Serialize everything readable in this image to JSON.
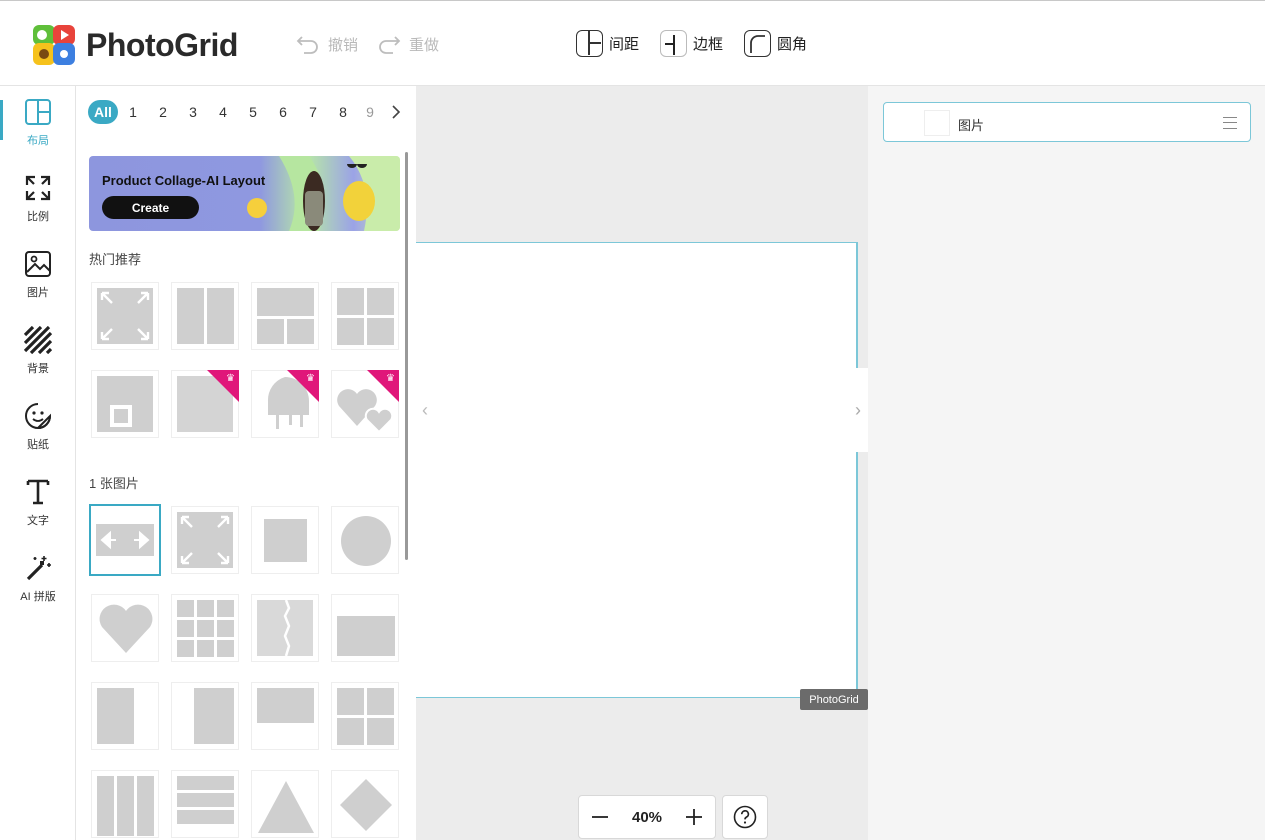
{
  "app": {
    "name": "PhotoGrid"
  },
  "header": {
    "undo_label": "撤销",
    "redo_label": "重做",
    "tools": [
      {
        "label": "间距",
        "icon": "spacing-icon"
      },
      {
        "label": "边框",
        "icon": "border-icon"
      },
      {
        "label": "圆角",
        "icon": "corner-radius-icon"
      }
    ]
  },
  "sidebar": {
    "items": [
      {
        "label": "布局",
        "icon": "layout-icon",
        "active": true
      },
      {
        "label": "比例",
        "icon": "ratio-icon"
      },
      {
        "label": "图片",
        "icon": "image-icon"
      },
      {
        "label": "背景",
        "icon": "background-icon"
      },
      {
        "label": "贴纸",
        "icon": "sticker-icon"
      },
      {
        "label": "文字",
        "icon": "text-icon"
      },
      {
        "label": "AI 拼版",
        "icon": "magic-wand-icon"
      }
    ]
  },
  "panel": {
    "pager": {
      "all": "All",
      "pages": [
        "1",
        "2",
        "3",
        "4",
        "5",
        "6",
        "7",
        "8",
        "9"
      ],
      "next_icon": "chevron-right-icon"
    },
    "banner": {
      "title": "Product Collage-AI Layout",
      "button": "Create"
    },
    "section_hot": "热门推荐",
    "section_one": "1 张图片"
  },
  "canvas": {
    "watermark": "PhotoGrid",
    "zoom": "40%"
  },
  "right": {
    "layer_label": "图片"
  },
  "colors": {
    "accent": "#3aa9c4",
    "premium": "#e0177a",
    "placeholder": "#cfcfcf"
  }
}
